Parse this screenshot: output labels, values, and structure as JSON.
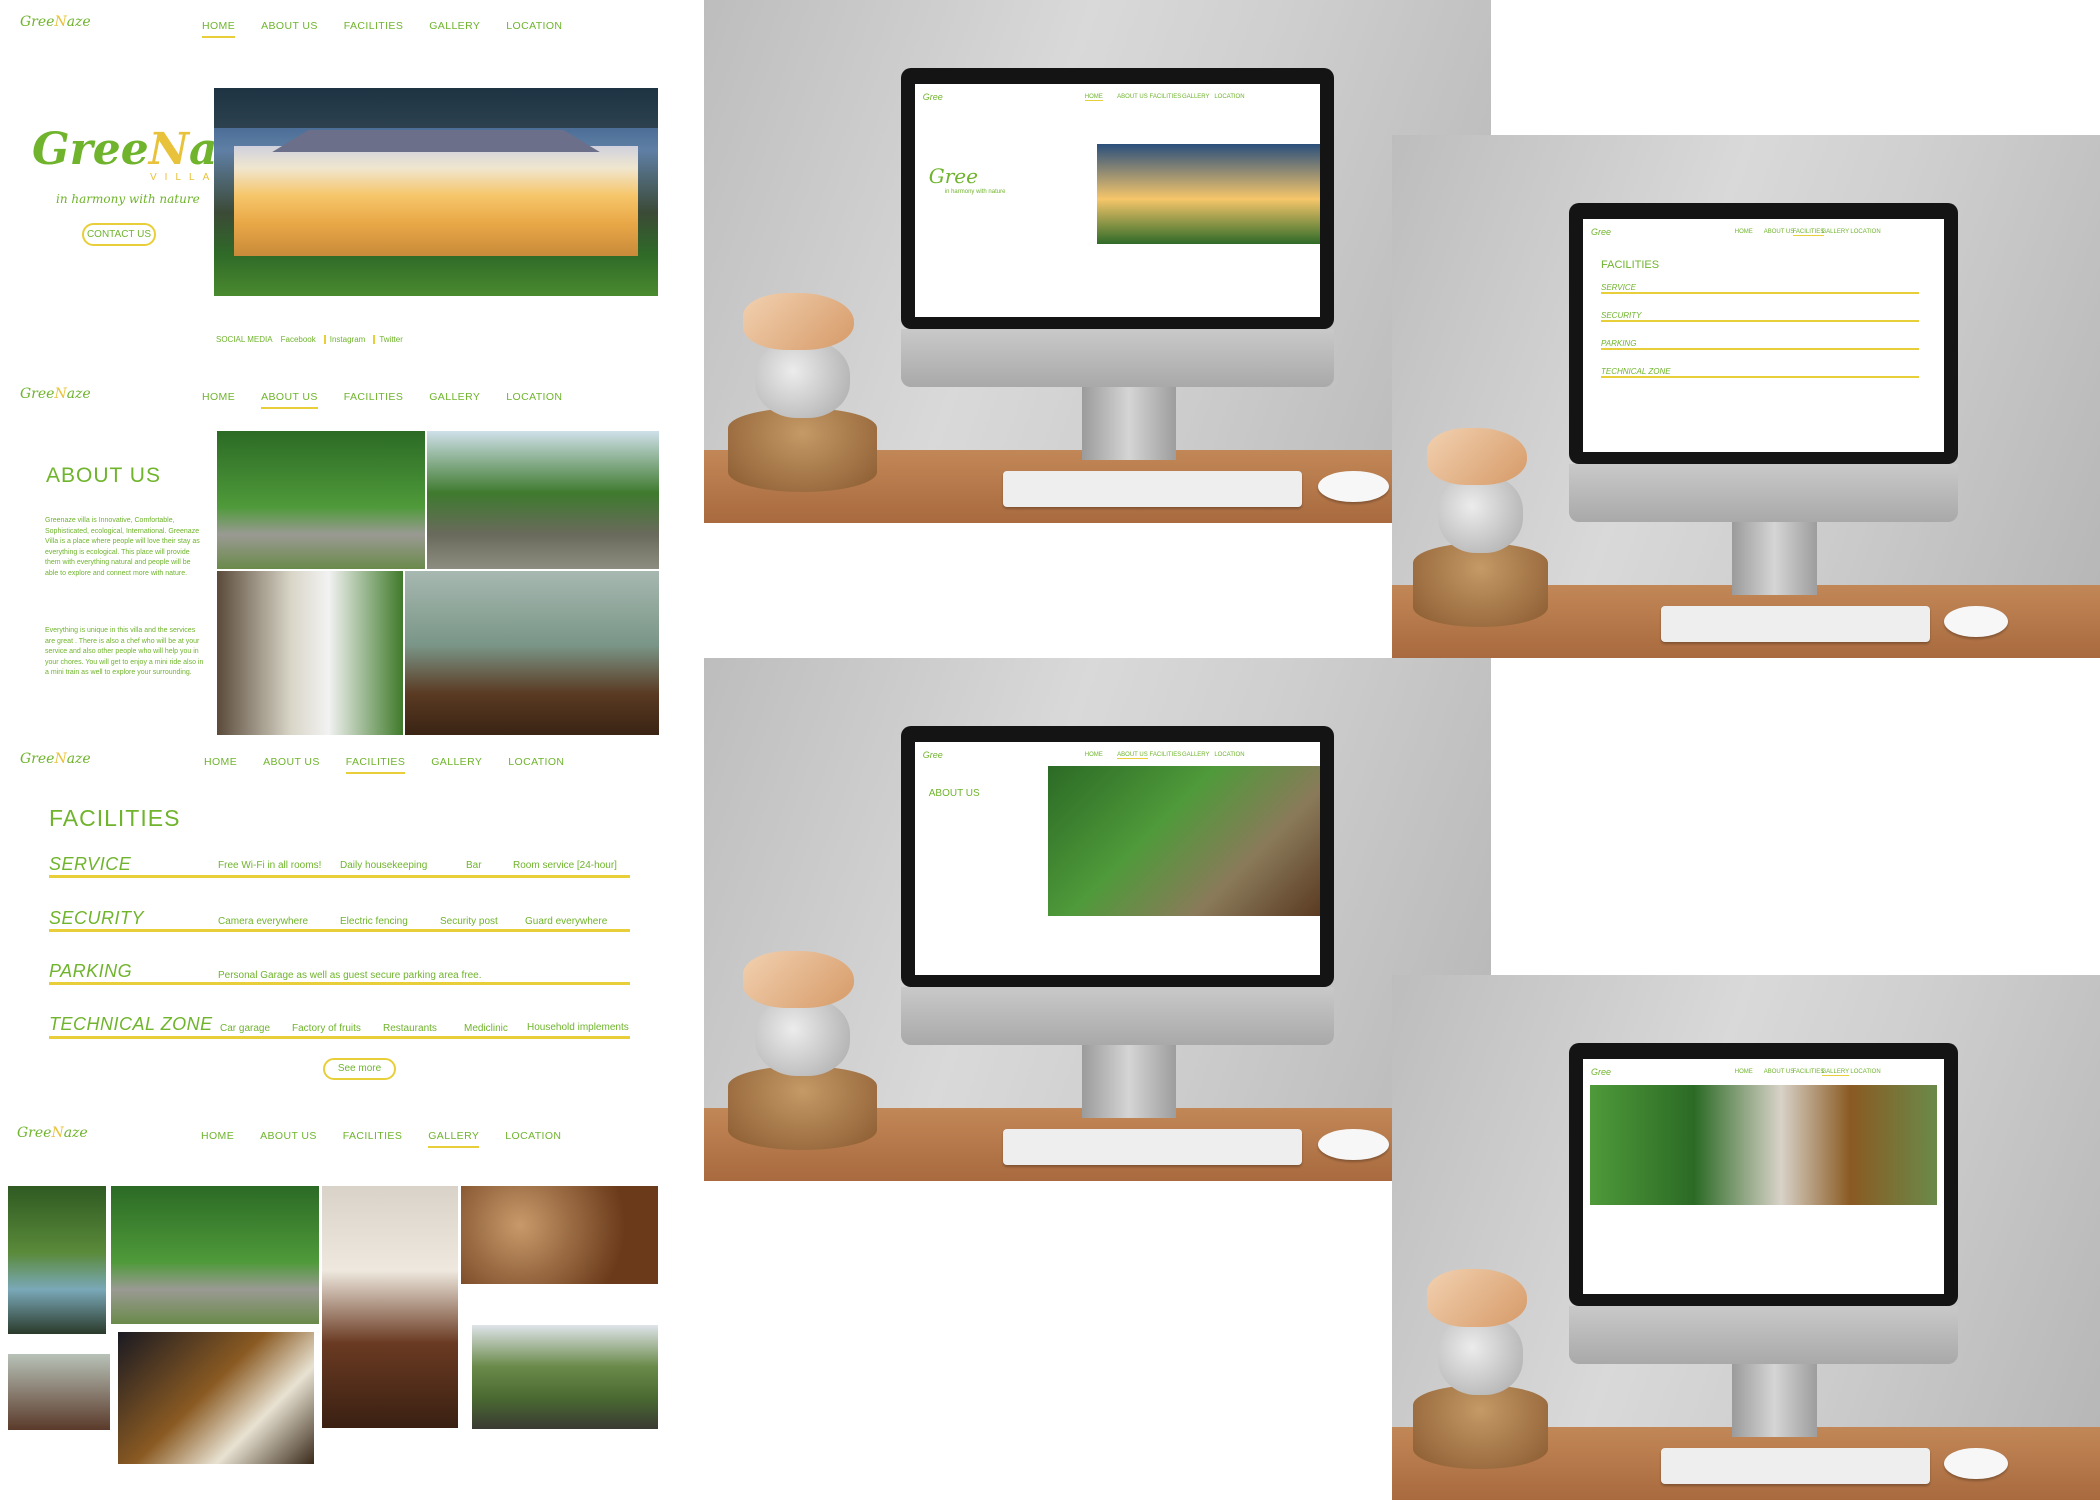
{
  "brand": {
    "logo_main": "Gree",
    "logo_mark": "N",
    "logo_end": "aze",
    "logo_sub": "VILLA",
    "tagline": "in harmony with nature"
  },
  "nav": {
    "home": "HOME",
    "about": "ABOUT US",
    "facilities": "FACILITIES",
    "gallery": "GALLERY",
    "location": "LOCATION"
  },
  "home": {
    "contact_button": "CONTACT US",
    "social_label": "SOCIAL MEDIA",
    "facebook": "Facebook",
    "instagram": "Instagram",
    "twitter": "Twitter"
  },
  "about": {
    "title": "ABOUT US",
    "para1": "Greenaze villa is Innovative, Comfortable, Sophisticated, ecological, International. Greenaze Villa is a place where people will love their stay as everything is ecological. This place will provide them with everything natural and people will be able to explore and connect more with nature.",
    "para2": "Everything is unique in this villa and the services are great . There is also a chef who will be at your service and also other people who will help you in your chores. You will get to enjoy a mini ride also in a mini train as well to explore your surrounding."
  },
  "facilities": {
    "title": "FACILITIES",
    "rows": [
      {
        "head": "SERVICE",
        "items": [
          "Free Wi-Fi in all rooms!",
          "Daily housekeeping",
          "Bar",
          "Room service [24-hour]"
        ]
      },
      {
        "head": "SECURITY",
        "items": [
          "Camera everywhere",
          "Electric fencing",
          "Security post",
          "Guard everywhere"
        ]
      },
      {
        "head": "PARKING",
        "items": [
          "Personal Garage as well as guest secure parking area free."
        ]
      },
      {
        "head": "TECHNICAL ZONE",
        "items": [
          "Car garage",
          "Factory of fruits",
          "Restaurants",
          "Mediclinic",
          "Household implements"
        ]
      }
    ],
    "see_more": "See more"
  },
  "colors": {
    "accent_green": "#6fb42c",
    "accent_yellow": "#e8cf3a"
  }
}
